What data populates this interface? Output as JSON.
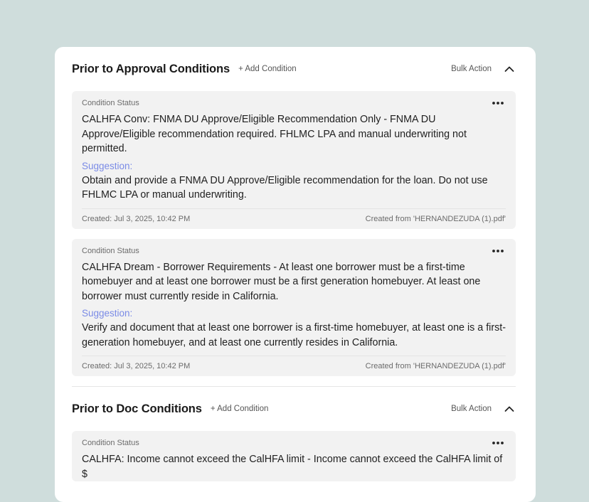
{
  "sections": [
    {
      "title": "Prior to Approval Conditions",
      "add_label": "+ Add Condition",
      "bulk_label": "Bulk Action",
      "cards": [
        {
          "status_label": "Condition Status",
          "text": "CALHFA Conv: FNMA DU Approve/Eligible Recommendation Only - FNMA DU Approve/Eligible recommendation required. FHLMC LPA and manual underwriting not permitted.",
          "suggestion_label": "Suggestion:",
          "suggestion_text": "Obtain and provide a FNMA DU Approve/Eligible recommendation for the loan. Do not use FHLMC LPA or manual underwriting.",
          "created": "Created: Jul 3, 2025, 10:42 PM",
          "source": "Created from 'HERNANDEZUDA (1).pdf'"
        },
        {
          "status_label": "Condition Status",
          "text": "CALHFA Dream - Borrower Requirements - At least one borrower must be a first-time homebuyer and at least one borrower must be a first generation homebuyer. At least one borrower must currently reside in California.",
          "suggestion_label": "Suggestion:",
          "suggestion_text": "Verify and document that at least one borrower is a first-time homebuyer, at least one is a first-generation homebuyer, and at least one currently resides in California.",
          "created": "Created: Jul 3, 2025, 10:42 PM",
          "source": "Created from 'HERNANDEZUDA (1).pdf'"
        }
      ]
    },
    {
      "title": "Prior to Doc Conditions",
      "add_label": "+ Add Condition",
      "bulk_label": "Bulk Action",
      "cards": [
        {
          "status_label": "Condition Status",
          "text": "CALHFA: Income cannot exceed the CalHFA limit - Income cannot exceed the CalHFA limit of $"
        }
      ]
    }
  ],
  "icons": {
    "collapse": "chevron-up-icon",
    "menu": "more-horizontal-icon"
  },
  "colors": {
    "background": "#cfdddc",
    "panel": "#ffffff",
    "card": "#f2f2f2",
    "suggestion": "#7a8be6"
  }
}
